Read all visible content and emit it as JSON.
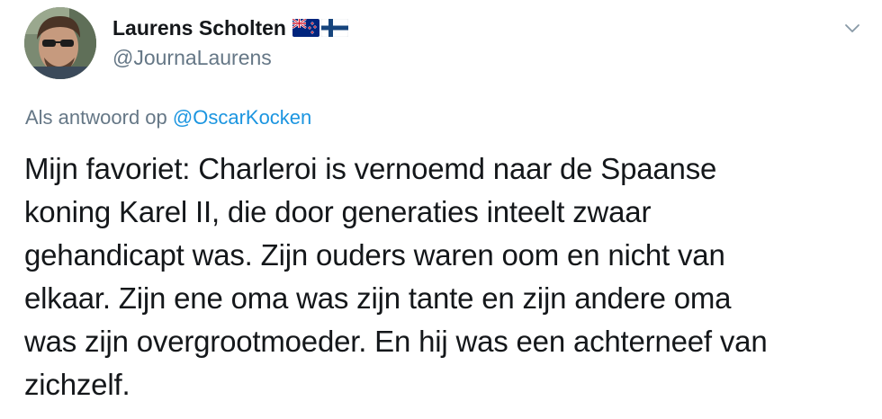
{
  "tweet": {
    "author": {
      "display_name": "Laurens Scholten",
      "handle": "@JournaLaurens",
      "flag_icons": [
        "new-zealand-flag-icon",
        "finland-flag-icon"
      ]
    },
    "reply": {
      "prefix": "Als antwoord op",
      "mention": "@OscarKocken"
    },
    "text_lines": [
      "Mijn favoriet: Charleroi is vernoemd naar de Spaanse",
      "koning Karel II, die door generaties inteelt zwaar",
      "gehandicapt was. Zijn ouders waren oom en nicht van",
      "elkaar. Zijn ene oma was zijn tante en zijn andere oma",
      "was zijn overgrootmoeder. En hij was een achterneef van",
      "zichzelf."
    ]
  },
  "colors": {
    "primary_text": "#14171a",
    "secondary_text": "#657786",
    "link": "#1b95e0"
  }
}
